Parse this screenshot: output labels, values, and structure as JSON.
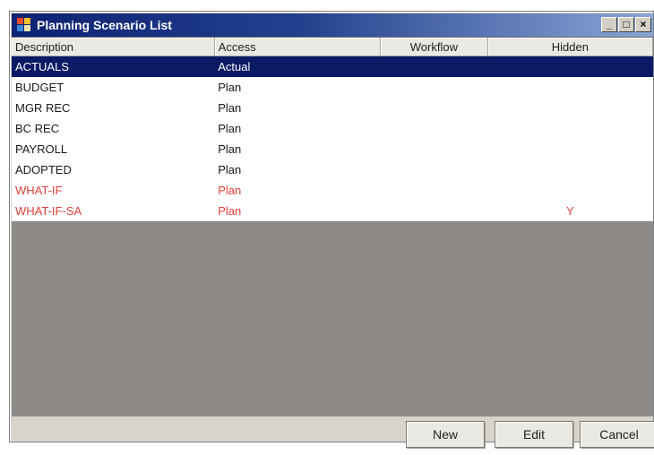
{
  "window": {
    "title": "Planning Scenario List",
    "controls": {
      "minimize": "_",
      "maximize": "□",
      "close": "×"
    }
  },
  "grid": {
    "columns": [
      "Description",
      "Access",
      "Workflow",
      "Hidden"
    ],
    "rows": [
      {
        "description": "ACTUALS",
        "access": "Actual",
        "workflow": "",
        "hidden": "",
        "selected": true
      },
      {
        "description": "BUDGET",
        "access": "Plan",
        "workflow": "",
        "hidden": ""
      },
      {
        "description": "MGR REC",
        "access": "Plan",
        "workflow": "",
        "hidden": ""
      },
      {
        "description": "BC REC",
        "access": "Plan",
        "workflow": "",
        "hidden": ""
      },
      {
        "description": "PAYROLL",
        "access": "Plan",
        "workflow": "",
        "hidden": ""
      },
      {
        "description": "ADOPTED",
        "access": "Plan",
        "workflow": "",
        "hidden": ""
      },
      {
        "description": "WHAT-IF",
        "access": "Plan",
        "workflow": "",
        "hidden": "",
        "highlight": "red"
      },
      {
        "description": "WHAT-IF-SA",
        "access": "Plan",
        "workflow": "",
        "hidden": "Y",
        "highlight": "red"
      }
    ]
  },
  "buttons": {
    "new": "New",
    "edit": "Edit",
    "cancel": "Cancel"
  },
  "colors": {
    "selected_row": "#0a1a64",
    "red_text": "#e0413a",
    "empty_area": "#8e8a88",
    "title_gradient_start": "#0c2272",
    "title_gradient_end": "#8aa6d6"
  }
}
